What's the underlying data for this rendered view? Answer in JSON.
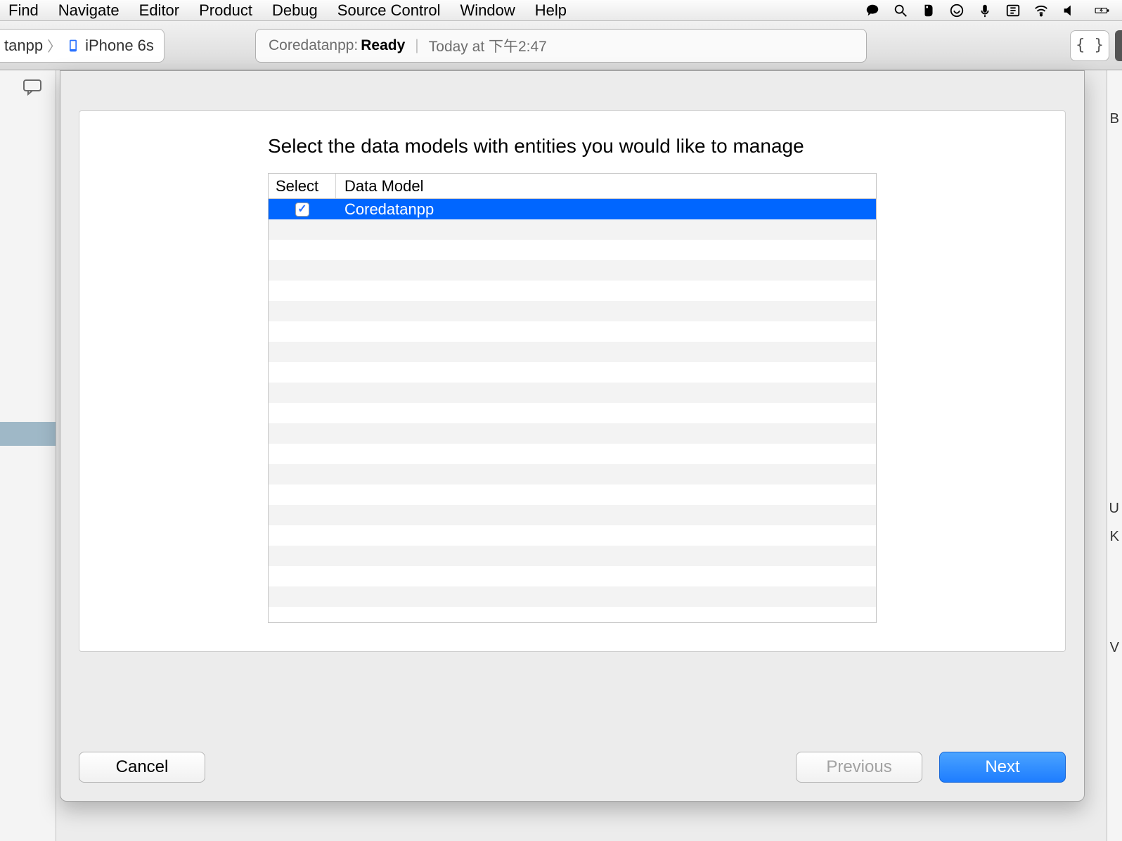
{
  "menubar": {
    "items": [
      "Find",
      "Navigate",
      "Editor",
      "Product",
      "Debug",
      "Source Control",
      "Window",
      "Help"
    ]
  },
  "toolbar": {
    "scheme_project": "tanpp",
    "scheme_device": "iPhone 6s",
    "activity_project": "Coredatanpp:",
    "activity_status": "Ready",
    "activity_time": "Today at 下午2:47",
    "brackets": "{ }"
  },
  "dialog": {
    "title": "Select the data models with entities you would like to manage",
    "columns": {
      "select": "Select",
      "model": "Data Model"
    },
    "rows": [
      {
        "checked": true,
        "name": "Coredatanpp",
        "selected": true
      }
    ],
    "buttons": {
      "cancel": "Cancel",
      "previous": "Previous",
      "next": "Next"
    }
  },
  "right_panel_letters": {
    "b": "B",
    "u": "U",
    "k": "K",
    "v": "V"
  }
}
